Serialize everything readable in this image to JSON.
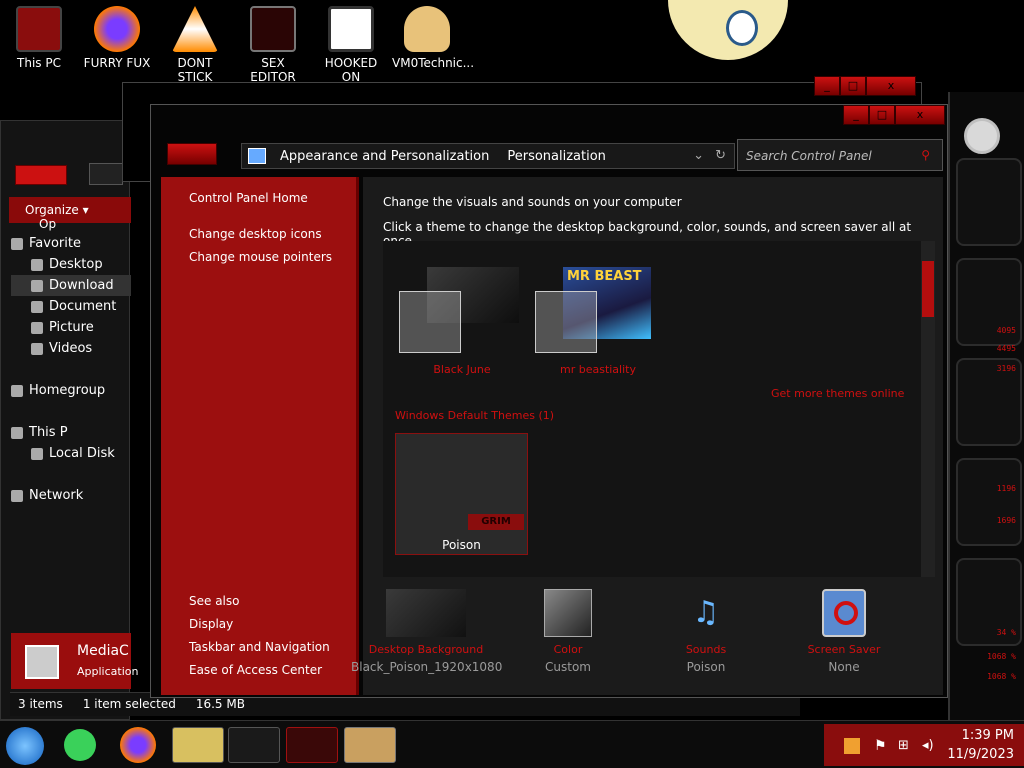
{
  "desktop": {
    "icons": [
      {
        "label": "This PC",
        "color": "#8a0d0d"
      },
      {
        "label": "FURRY FUX",
        "color": "#ff7a00"
      },
      {
        "label": "DONT STICK",
        "color": "#ff8c00"
      },
      {
        "label": "SEX EDITOR",
        "color": "#6a0a0a"
      },
      {
        "label": "HOOKED ON",
        "color": "#c0c0c0"
      },
      {
        "label": "VM0Technic...",
        "color": "#e8c27a"
      }
    ]
  },
  "explorer": {
    "toolbar": {
      "organize": "Organize",
      "op": "Op"
    },
    "tree": [
      "Favorite",
      "Desktop",
      "Download",
      "Document",
      "Picture",
      "Videos",
      "Homegroup",
      "This P",
      "Local Disk",
      "Network"
    ],
    "details": {
      "name": "MediaC",
      "type": "Application"
    },
    "status": {
      "items": "3 items",
      "selected": "1 item selected",
      "size": "16.5 MB"
    }
  },
  "cp": {
    "breadcrumb": [
      "Appearance and Personalization",
      "Personalization"
    ],
    "search_placeholder": "Search Control Panel",
    "sidebar_top": [
      "Control Panel Home",
      "Change desktop icons",
      "Change mouse pointers"
    ],
    "see_also_title": "See also",
    "see_also": [
      "Display",
      "Taskbar and Navigation",
      "Ease of Access Center"
    ],
    "heading": "Change the visuals and sounds on your computer",
    "subheading": "Click a theme to change the desktop background, color, sounds, and screen saver all at once.",
    "themes_my": [
      "Black June",
      "mr beastiality"
    ],
    "get_more": "Get more themes online",
    "default_group": "Windows Default Themes (1)",
    "default_themes": [
      "Poison"
    ],
    "poster_text": "MR BEAST",
    "badge_text": "GRIM",
    "bottom": [
      {
        "label": "Desktop Background",
        "value": "Black_Poison_1920x1080"
      },
      {
        "label": "Color",
        "value": "Custom"
      },
      {
        "label": "Sounds",
        "value": "Poison"
      },
      {
        "label": "Screen Saver",
        "value": "None"
      }
    ]
  },
  "gadget": {
    "readings": [
      "4095",
      "4495",
      "3196",
      "1196",
      "1696",
      "34 %",
      "1068 %",
      "1068 %"
    ]
  },
  "taskbar": {
    "time": "1:39 PM",
    "date": "11/9/2023"
  },
  "colors": {
    "accent": "#9c0f0f",
    "accent_bright": "#d01010",
    "window_bg": "#1b1b1b"
  }
}
